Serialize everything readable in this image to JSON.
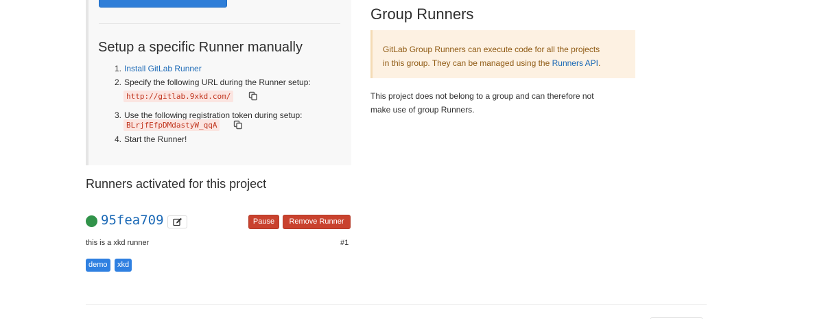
{
  "setup": {
    "title": "Setup a specific Runner manually",
    "steps": [
      {
        "num": "1.",
        "text": "",
        "link": "Install GitLab Runner"
      },
      {
        "num": "2.",
        "text": "Specify the following URL during the Runner setup:",
        "code": "http://gitlab.9xkd.com/"
      },
      {
        "num": "3.",
        "text": "Use the following registration token during setup:",
        "code": "BLrjfEfpDMdastyW_qqA"
      },
      {
        "num": "4.",
        "text": "Start the Runner!"
      }
    ]
  },
  "runners": {
    "title": "Runners activated for this project",
    "items": [
      {
        "id": "95fea709",
        "status_color": "#31934a",
        "description": "this is a xkd runner",
        "number": "#1",
        "pause_label": "Pause",
        "remove_label": "Remove Runner",
        "tags": [
          "demo",
          "xkd"
        ]
      }
    ]
  },
  "group": {
    "title": "Group Runners",
    "info_line1": "GitLab Group Runners can execute code for all the projects",
    "info_line2_prefix": "in this group. They can be managed using the ",
    "info_link": "Runners API",
    "info_suffix": ".",
    "note_line1": "This project does not belong to a group and can therefore not",
    "note_line2": "make use of group Runners."
  },
  "icons": {
    "copy": "copy-icon",
    "edit": "edit-icon"
  },
  "colors": {
    "link": "#1b69b6",
    "danger": "#c9422e",
    "tag": "#2f80e1",
    "warning_bg": "#fdf1e2"
  }
}
